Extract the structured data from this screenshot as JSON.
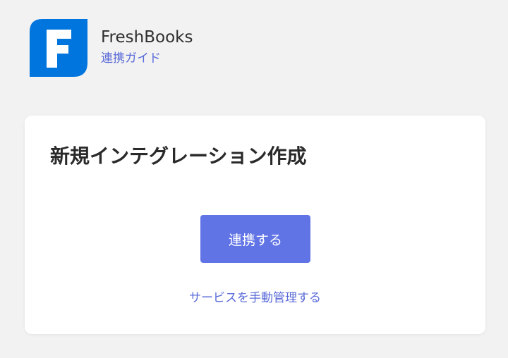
{
  "app": {
    "name": "FreshBooks",
    "subtitle_link": "連携ガイド",
    "logo_icon": "freshbooks-logo-icon",
    "logo_letter": "F"
  },
  "card": {
    "title": "新規インテグレーション作成",
    "connect_label": "連携する",
    "manual_link": "サービスを手動管理する"
  },
  "colors": {
    "background": "#f2f2f2",
    "brand_blue": "#0075dd",
    "accent": "#6174e6",
    "link": "#5a6bd8"
  }
}
